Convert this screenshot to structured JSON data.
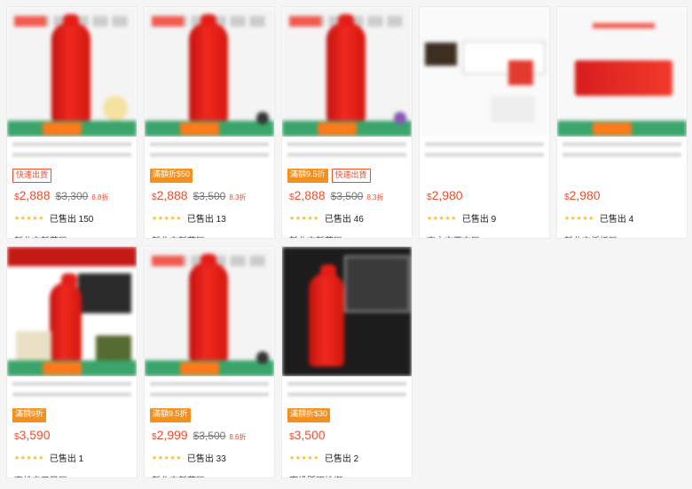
{
  "products": [
    {
      "thumb": "photo",
      "accent": "ball",
      "tags": [
        {
          "text": "快速出貨",
          "style": "outline"
        }
      ],
      "price": "2,888",
      "original": "3,300",
      "discount": "8.8折",
      "sold": "已售出 150",
      "location": "新北市新莊區"
    },
    {
      "thumb": "photo",
      "accent": "knob",
      "tags": [
        {
          "text": "滿額折$50",
          "style": "fill"
        }
      ],
      "price": "2,888",
      "original": "3,500",
      "discount": "8.3折",
      "sold": "已售出 13",
      "location": "新北市新莊區"
    },
    {
      "thumb": "photo",
      "accent": "knob-purple",
      "tags": [
        {
          "text": "滿額9.5折",
          "style": "fill"
        },
        {
          "text": "快速出貨",
          "style": "outline"
        }
      ],
      "price": "2,888",
      "original": "3,500",
      "discount": "8.3折",
      "sold": "已售出 46",
      "location": "新北市新莊區"
    },
    {
      "thumb": "scene",
      "accent": "",
      "tags": [],
      "price": "2,980",
      "original": "",
      "discount": "",
      "sold": "已售出 9",
      "location": "臺中市西屯區"
    },
    {
      "thumb": "case",
      "accent": "",
      "tags": [],
      "price": "2,980",
      "original": "",
      "discount": "",
      "sold": "已售出 4",
      "location": "新北市板橋區"
    },
    {
      "thumb": "switch",
      "accent": "",
      "tags": [
        {
          "text": "滿額9折",
          "style": "fill"
        }
      ],
      "price": "3,590",
      "original": "",
      "discount": "",
      "sold": "已售出 1",
      "location": "高雄市三民區"
    },
    {
      "thumb": "photo",
      "accent": "knob",
      "tags": [
        {
          "text": "滿額9.5折",
          "style": "fill"
        }
      ],
      "price": "2,999",
      "original": "3,500",
      "discount": "8.6折",
      "sold": "已售出 33",
      "location": "新北市新莊區"
    },
    {
      "thumb": "dark",
      "accent": "",
      "tags": [
        {
          "text": "滿額折$30",
          "style": "fill"
        }
      ],
      "price": "3,500",
      "original": "",
      "discount": "",
      "sold": "已售出 2",
      "location": "南投縣國姓鄉"
    }
  ],
  "currency_symbol": "$",
  "rating_icon": "star-icon",
  "colors": {
    "price": "#ee4d2d",
    "tag_fill": "#f4901e",
    "star": "#f6c323"
  }
}
